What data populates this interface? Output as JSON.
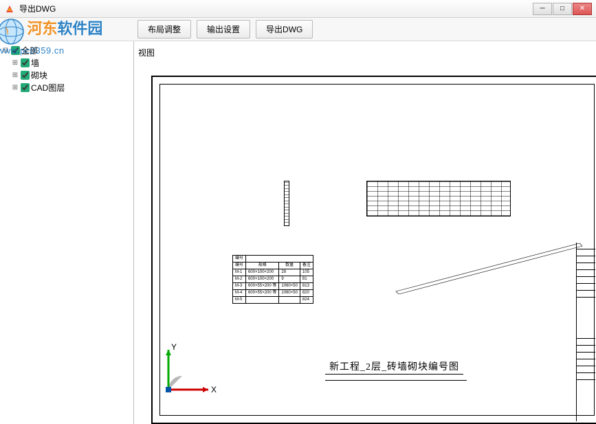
{
  "window": {
    "title": "导出DWG"
  },
  "toolbar": {
    "layout_btn": "布局调整",
    "output_btn": "输出设置",
    "export_btn": "导出DWG"
  },
  "tree": {
    "root": "全部",
    "items": [
      "墙",
      "砌块",
      "CAD图层"
    ]
  },
  "viewport": {
    "label": "视图"
  },
  "drawing": {
    "title_text": "新工程_2层_砖墙砌块编号图"
  },
  "table": {
    "header_label": "编号",
    "cols": [
      "编号",
      "规格",
      "数量",
      "备注"
    ],
    "rows": [
      [
        "M-1",
        "600×100×200",
        "28",
        "105"
      ],
      [
        "M-2",
        "600×100×200",
        "9",
        "81"
      ],
      [
        "M-3",
        "600×55×200 等",
        "1060×50",
        "813"
      ],
      [
        "M-4",
        "600×55×200 等",
        "1060×50",
        "820"
      ],
      [
        "M-5",
        "",
        "",
        "824"
      ]
    ]
  },
  "ucs": {
    "x": "X",
    "y": "Y"
  },
  "watermark": {
    "brand_a": "河东",
    "brand_b": "软件园",
    "url": "www.pc0359.cn"
  }
}
